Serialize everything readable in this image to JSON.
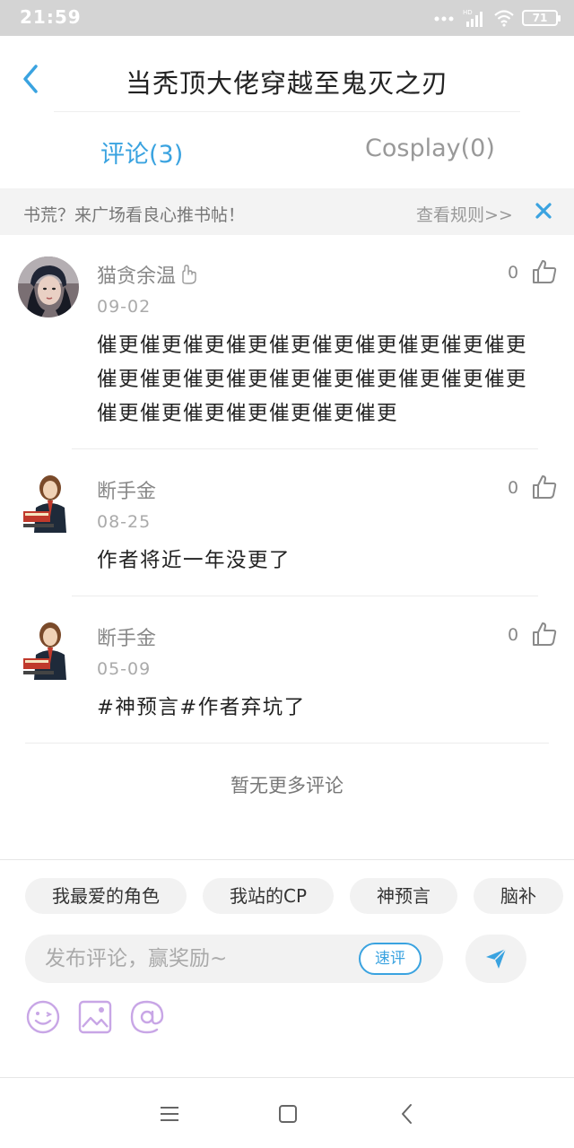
{
  "status_bar": {
    "time": "21:59",
    "battery": "71",
    "network_label": "HD"
  },
  "header": {
    "title": "当秃顶大佬穿越至鬼灭之刃",
    "back_icon": "chevron-left-icon"
  },
  "tabs": [
    {
      "label": "评论(3)",
      "active": true
    },
    {
      "label": "Cosplay(0)",
      "active": false
    }
  ],
  "banner": {
    "text": "书荒？来广场看良心推书帖！",
    "rules_link": "查看规则>>",
    "close_icon": "close-icon"
  },
  "comments": [
    {
      "username": "猫贪余温",
      "date": "09-02",
      "likes": "0",
      "text": "催更催更催更催更催更催更催更催更催更催更催更催更催更催更催更催更催更催更催更催更催更催更催更催更催更催更催更"
    },
    {
      "username": "断手金",
      "date": "08-25",
      "likes": "0",
      "text": "作者将近一年没更了"
    },
    {
      "username": "断手金",
      "date": "05-09",
      "likes": "0",
      "text": "#神预言#作者弃坑了"
    }
  ],
  "no_more_text": "暂无更多评论",
  "composer": {
    "tags": [
      "我最爱的角色",
      "我站的CP",
      "神预言",
      "脑补"
    ],
    "input_placeholder": "发布评论，赢奖励~",
    "quick_review_label": "速评",
    "send_icon": "send-icon",
    "tool_icons": [
      "emoji-icon",
      "image-icon",
      "mention-icon"
    ]
  },
  "colors": {
    "accent": "#3aa3e0",
    "tool_purple": "#c8a6e6",
    "status_bar_bg": "#d4d4d4"
  }
}
